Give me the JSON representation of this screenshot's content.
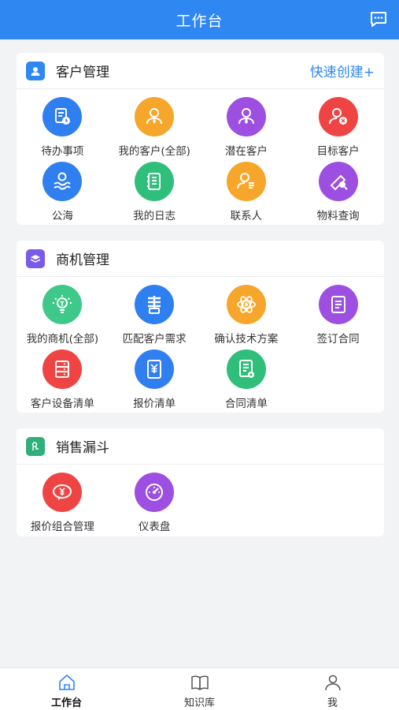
{
  "header": {
    "title": "工作台"
  },
  "colors": {
    "primary": "#2f87f2"
  },
  "customer": {
    "title": "客户管理",
    "quick_create": "快速创建+",
    "items": [
      {
        "label": "待办事项",
        "icon": "todo-icon",
        "color": "#2f7ff0"
      },
      {
        "label": "我的客户(全部)",
        "icon": "my-customer-icon",
        "color": "#f6a62a"
      },
      {
        "label": "潜在客户",
        "icon": "potential-customer-icon",
        "color": "#9c4fe0"
      },
      {
        "label": "目标客户",
        "icon": "target-customer-icon",
        "color": "#ef4444"
      },
      {
        "label": "公海",
        "icon": "public-sea-icon",
        "color": "#2f7ff0"
      },
      {
        "label": "我的日志",
        "icon": "journal-icon",
        "color": "#2fbf7b"
      },
      {
        "label": "联系人",
        "icon": "contact-icon",
        "color": "#f6a62a"
      },
      {
        "label": "物料查询",
        "icon": "material-search-icon",
        "color": "#9c4fe0"
      }
    ]
  },
  "opportunity": {
    "title": "商机管理",
    "items": [
      {
        "label": "我的商机(全部)",
        "icon": "bulb-icon",
        "color": "#3ec98a"
      },
      {
        "label": "匹配客户需求",
        "icon": "match-icon",
        "color": "#2f7ff0"
      },
      {
        "label": "确认技术方案",
        "icon": "atom-icon",
        "color": "#f6a62a"
      },
      {
        "label": "签订合同",
        "icon": "sign-contract-icon",
        "color": "#9c4fe0"
      },
      {
        "label": "客户设备清单",
        "icon": "device-list-icon",
        "color": "#ef4444"
      },
      {
        "label": "报价清单",
        "icon": "quote-list-icon",
        "color": "#2f7ff0"
      },
      {
        "label": "合同清单",
        "icon": "contract-list-icon",
        "color": "#2fbf7b"
      }
    ]
  },
  "funnel": {
    "title": "销售漏斗",
    "items": [
      {
        "label": "报价组合管理",
        "icon": "quote-combo-icon",
        "color": "#ef4444"
      },
      {
        "label": "仪表盘",
        "icon": "dashboard-icon",
        "color": "#9c4fe0"
      }
    ]
  },
  "tabbar": {
    "items": [
      {
        "label": "工作台",
        "icon": "home-icon",
        "active": true
      },
      {
        "label": "知识库",
        "icon": "book-icon",
        "active": false
      },
      {
        "label": "我",
        "icon": "person-icon",
        "active": false
      }
    ]
  }
}
